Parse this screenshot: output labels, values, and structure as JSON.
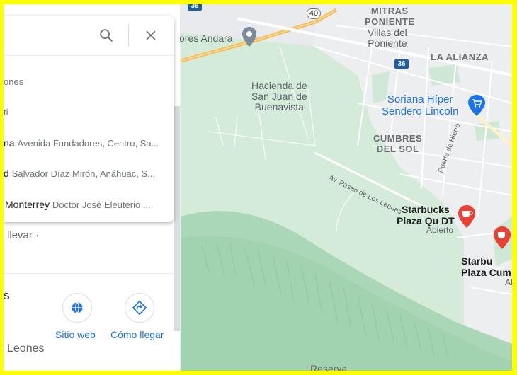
{
  "search": {
    "value": "",
    "placeholder": "",
    "suggestions": [
      {
        "primary": "ones",
        "secondary": ""
      },
      {
        "primary": "ti",
        "secondary": ""
      },
      {
        "primary": "na",
        "secondary": "Avenida Fundadores, Centro, Sa..."
      },
      {
        "primary": "d",
        "secondary": "Salvador Díaz Mirón, Anáhuac, S..."
      },
      {
        "primary": "Monterrey",
        "secondary": "Doctor José Eleuterio ..."
      }
    ]
  },
  "panel": {
    "partial_text_llevar": "llevar ·",
    "partial_heading": "s",
    "actions": [
      {
        "label": "Sitio web",
        "icon": "globe-icon"
      },
      {
        "label": "Cómo llegar",
        "icon": "directions-icon"
      }
    ],
    "bottom_text": "Leones"
  },
  "map": {
    "labels": {
      "mitras_poniente": "MITRAS\nPONIENTE",
      "villas_poniente": "Villas del\nPoniente",
      "la_alianza": "LA ALIANZA",
      "hacienda": "Hacienda de\nSan Juan de\nBuenavista",
      "cumbres_del_sol": "CUMBRES\nDEL SOL",
      "andara": "ores Andara",
      "soriana": "Soriana Híper\nSendero Lincoln",
      "starbucks_1": "Starbucks\nPlaza Qu DT",
      "starbucks_1_status": "Abierto",
      "starbucks_2": "Starbu\nPlaza Cum",
      "starbucks_2_sub": "Ab",
      "road_paseo": "Av. Paseo de Los Leones",
      "road_hierro": "Puerta de Hierro",
      "reserva": "Reserva",
      "hw_40": "40",
      "hw_36": "36",
      "hw_top": "36"
    }
  },
  "colors": {
    "accent": "#1a73e8",
    "poi_red": "#e94235",
    "park_green": "#cfe8d5",
    "mountain_green": "#a8d8b9",
    "highway": "#f5b950",
    "frame": "#ffff00"
  }
}
